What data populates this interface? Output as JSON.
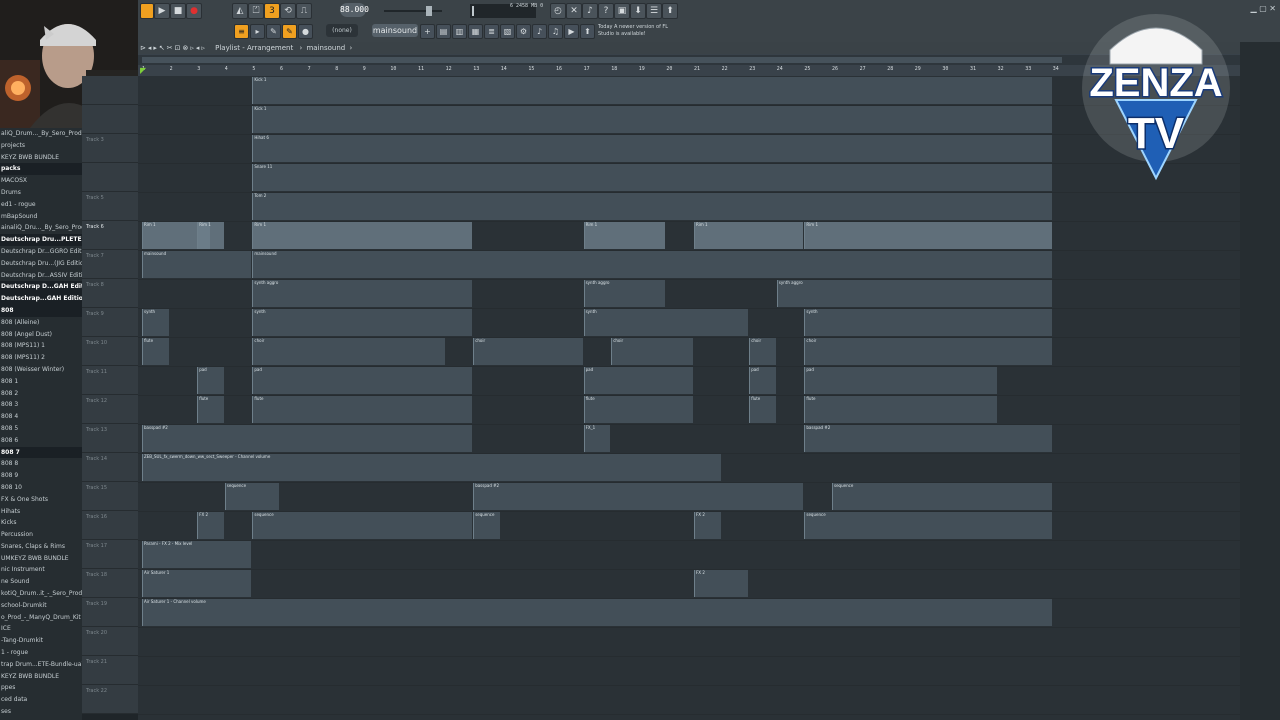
{
  "toolbar": {
    "time": "1:01:00",
    "tempo": "88.000",
    "pattern": "mainsound",
    "pattern_none": "(none)",
    "news_line1": "Today A newer version of FL",
    "news_line2": "Studio is available!",
    "cpu_num": "6",
    "cpu_mem": "2458 MB",
    "cpu_zero": "0"
  },
  "playlist": {
    "title": "Playlist - Arrangement",
    "breadcrumb": "mainsound"
  },
  "ruler": [
    "1",
    "2",
    "3",
    "4",
    "5",
    "6",
    "7",
    "8",
    "9",
    "10",
    "11",
    "12",
    "13",
    "14",
    "15",
    "16",
    "17",
    "18",
    "19",
    "20",
    "21",
    "22",
    "23",
    "24",
    "25",
    "26",
    "27",
    "28",
    "29",
    "30",
    "31",
    "32",
    "33",
    "34"
  ],
  "browser": [
    {
      "label": "aliQ_Drum..._By_Sero_Prod",
      "hl": false
    },
    {
      "label": "projects",
      "hl": false
    },
    {
      "label": "KEYZ BWB BUNDLE",
      "hl": false
    },
    {
      "label": "packs",
      "hl": true
    },
    {
      "label": "MACOSX",
      "hl": false
    },
    {
      "label": "Drums",
      "hl": false
    },
    {
      "label": "ed1 - rogue",
      "hl": false
    },
    {
      "label": "mBapSound",
      "hl": false
    },
    {
      "label": "ainaliQ_Dru..._By_Sero_Prod",
      "hl": false
    },
    {
      "label": "Deutschrap Dru...PLETE Bundle)",
      "hl": true
    },
    {
      "label": "Deutschrap Dr...GGRO Edition)",
      "hl": false
    },
    {
      "label": "Deutschrap Dru...(JIG Edition)",
      "hl": false
    },
    {
      "label": "Deutschrap Dr...ASSIV Edition)",
      "hl": false
    },
    {
      "label": "Deutschrap D...GAH Edition)",
      "hl": true
    },
    {
      "label": "Deutschrap...GAH Edition)",
      "hl": true
    },
    {
      "label": "808",
      "hl": true
    },
    {
      "label": "808 (Alleine)",
      "hl": false
    },
    {
      "label": "808 (Angel Dust)",
      "hl": false
    },
    {
      "label": "808 (MPS11) 1",
      "hl": false
    },
    {
      "label": "808 (MPS11) 2",
      "hl": false
    },
    {
      "label": "808 (Weisser Winter)",
      "hl": false
    },
    {
      "label": "808 1",
      "hl": false
    },
    {
      "label": "808 2",
      "hl": false
    },
    {
      "label": "808 3",
      "hl": false
    },
    {
      "label": "808 4",
      "hl": false
    },
    {
      "label": "808 5",
      "hl": false
    },
    {
      "label": "808 6",
      "hl": false
    },
    {
      "label": "808 7",
      "hl": true
    },
    {
      "label": "808 8",
      "hl": false
    },
    {
      "label": "808 9",
      "hl": false
    },
    {
      "label": "808 10",
      "hl": false
    },
    {
      "label": "FX & One Shots",
      "hl": false
    },
    {
      "label": "Hihats",
      "hl": false
    },
    {
      "label": "Kicks",
      "hl": false
    },
    {
      "label": "Percussion",
      "hl": false
    },
    {
      "label": "Snares, Claps & Rims",
      "hl": false
    },
    {
      "label": "UMKEYZ BWB BUNDLE",
      "hl": false
    },
    {
      "label": "nic Instrument",
      "hl": false
    },
    {
      "label": "ne Sound",
      "hl": false
    },
    {
      "label": "kotiQ_Drum..it_-_Sero_Prod",
      "hl": false
    },
    {
      "label": "school-Drumkit",
      "hl": false
    },
    {
      "label": "o_Prod_-_ManyQ_Drum_Kit",
      "hl": false
    },
    {
      "label": "ICE",
      "hl": false
    },
    {
      "label": "-Tang-Drumkit",
      "hl": false
    },
    {
      "label": "1 - rogue",
      "hl": false
    },
    {
      "label": "trap Drum...ETE-Bundle-ua7pck",
      "hl": false
    },
    {
      "label": "KEYZ BWB BUNDLE",
      "hl": false
    },
    {
      "label": "ppes",
      "hl": false
    },
    {
      "label": "ced data",
      "hl": false
    },
    {
      "label": "ses",
      "hl": false
    }
  ],
  "tracks": [
    {
      "name": "",
      "active": false,
      "clips": []
    },
    {
      "name": "",
      "active": false,
      "clips": []
    },
    {
      "name": "Track 3",
      "active": false,
      "clips": []
    },
    {
      "name": "",
      "active": false,
      "clips": []
    },
    {
      "name": "Track 5",
      "active": false,
      "clips": []
    },
    {
      "name": "Track 6",
      "active": true,
      "clips": []
    },
    {
      "name": "Track 7",
      "active": false,
      "clips": []
    },
    {
      "name": "Track 8",
      "active": false,
      "clips": []
    },
    {
      "name": "Track 9",
      "active": false,
      "clips": []
    },
    {
      "name": "Track 10",
      "active": false,
      "clips": []
    },
    {
      "name": "Track 11",
      "active": false,
      "clips": []
    },
    {
      "name": "Track 12",
      "active": false,
      "clips": []
    },
    {
      "name": "Track 13",
      "active": false,
      "clips": []
    },
    {
      "name": "Track 14",
      "active": false,
      "clips": []
    },
    {
      "name": "Track 15",
      "active": false,
      "clips": []
    },
    {
      "name": "Track 16",
      "active": false,
      "clips": []
    },
    {
      "name": "Track 17",
      "active": false,
      "clips": []
    },
    {
      "name": "Track 18",
      "active": false,
      "clips": []
    },
    {
      "name": "Track 19",
      "active": false,
      "clips": []
    },
    {
      "name": "Track 20",
      "active": false,
      "clips": []
    },
    {
      "name": "Track 21",
      "active": false,
      "clips": []
    },
    {
      "name": "Track 22",
      "active": false,
      "clips": []
    }
  ],
  "clip_labels": {
    "kick": "Kick 1",
    "snare": "Snare 11",
    "hihat": "Hihat 6",
    "tom": "Tom 2",
    "rim": "Rim 3",
    "track6": "Rim 1",
    "main": "mainsound",
    "synth": "synth aggro",
    "synth2": "synth",
    "flute": "flute",
    "choir": "choir",
    "pad": "pad",
    "bass": "basspad #2",
    "fx": "FX_1",
    "vox": "ZEB_SUL_fx_swerm_down_ww_sect_Sweeper - Channel volume",
    "sweep": "sequence",
    "fx2": "FX 2",
    "param": "Parami - FX 2 - Mix level",
    "ani": "Air Saturer 1",
    "ani2": "Air Saturer 1 - Channel volume"
  },
  "logo": {
    "line1": "ZENZA",
    "line2": "TV"
  },
  "colors": {
    "accent": "#f0a020",
    "clip": "#58687a",
    "logo_blue": "#1f5fb5"
  }
}
